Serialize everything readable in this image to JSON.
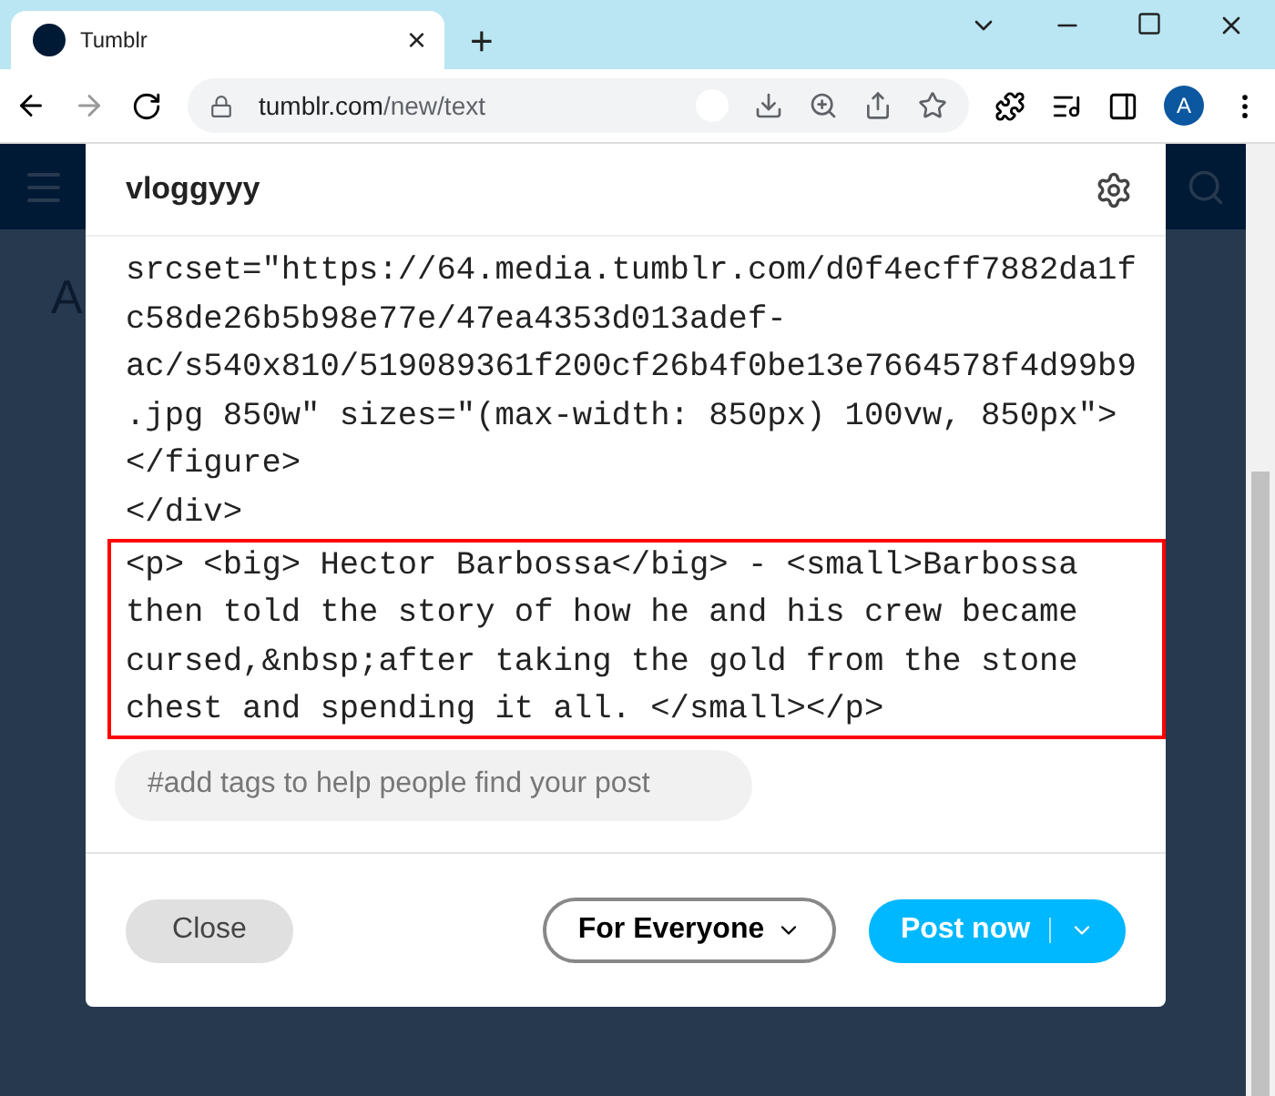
{
  "browser": {
    "tab": {
      "title": "Tumblr",
      "close": "×",
      "selected": true
    },
    "new_tab": "+",
    "url": {
      "host": "tumblr.com",
      "path": "/new/text"
    },
    "profile": "A"
  },
  "background": {
    "heading": "A"
  },
  "modal": {
    "blog": "vloggyyy",
    "code_lines": [
      "srcset=\"https://64.media.tumblr.com/d0f4ecff7882da1f",
      "c58de26b5b98e77e/47ea4353d013adef-",
      "ac/s540x810/519089361f200cf26b4f0be13e7664578f4d99b9",
      ".jpg 850w\" sizes=\"(max-width: 850px) 100vw, 850px\">",
      "</figure>",
      "</div>"
    ],
    "highlighted_lines": [
      "<p> <big> Hector Barbossa</big> - <small>Barbossa",
      "then told the story of how he and his crew became",
      "cursed,&nbsp;after taking the gold from the stone",
      "chest and spending it all. </small></p>"
    ],
    "tags": {
      "placeholder": "#add tags to help people find your post"
    },
    "close": "Close",
    "audience": "For Everyone",
    "post": "Post now"
  }
}
